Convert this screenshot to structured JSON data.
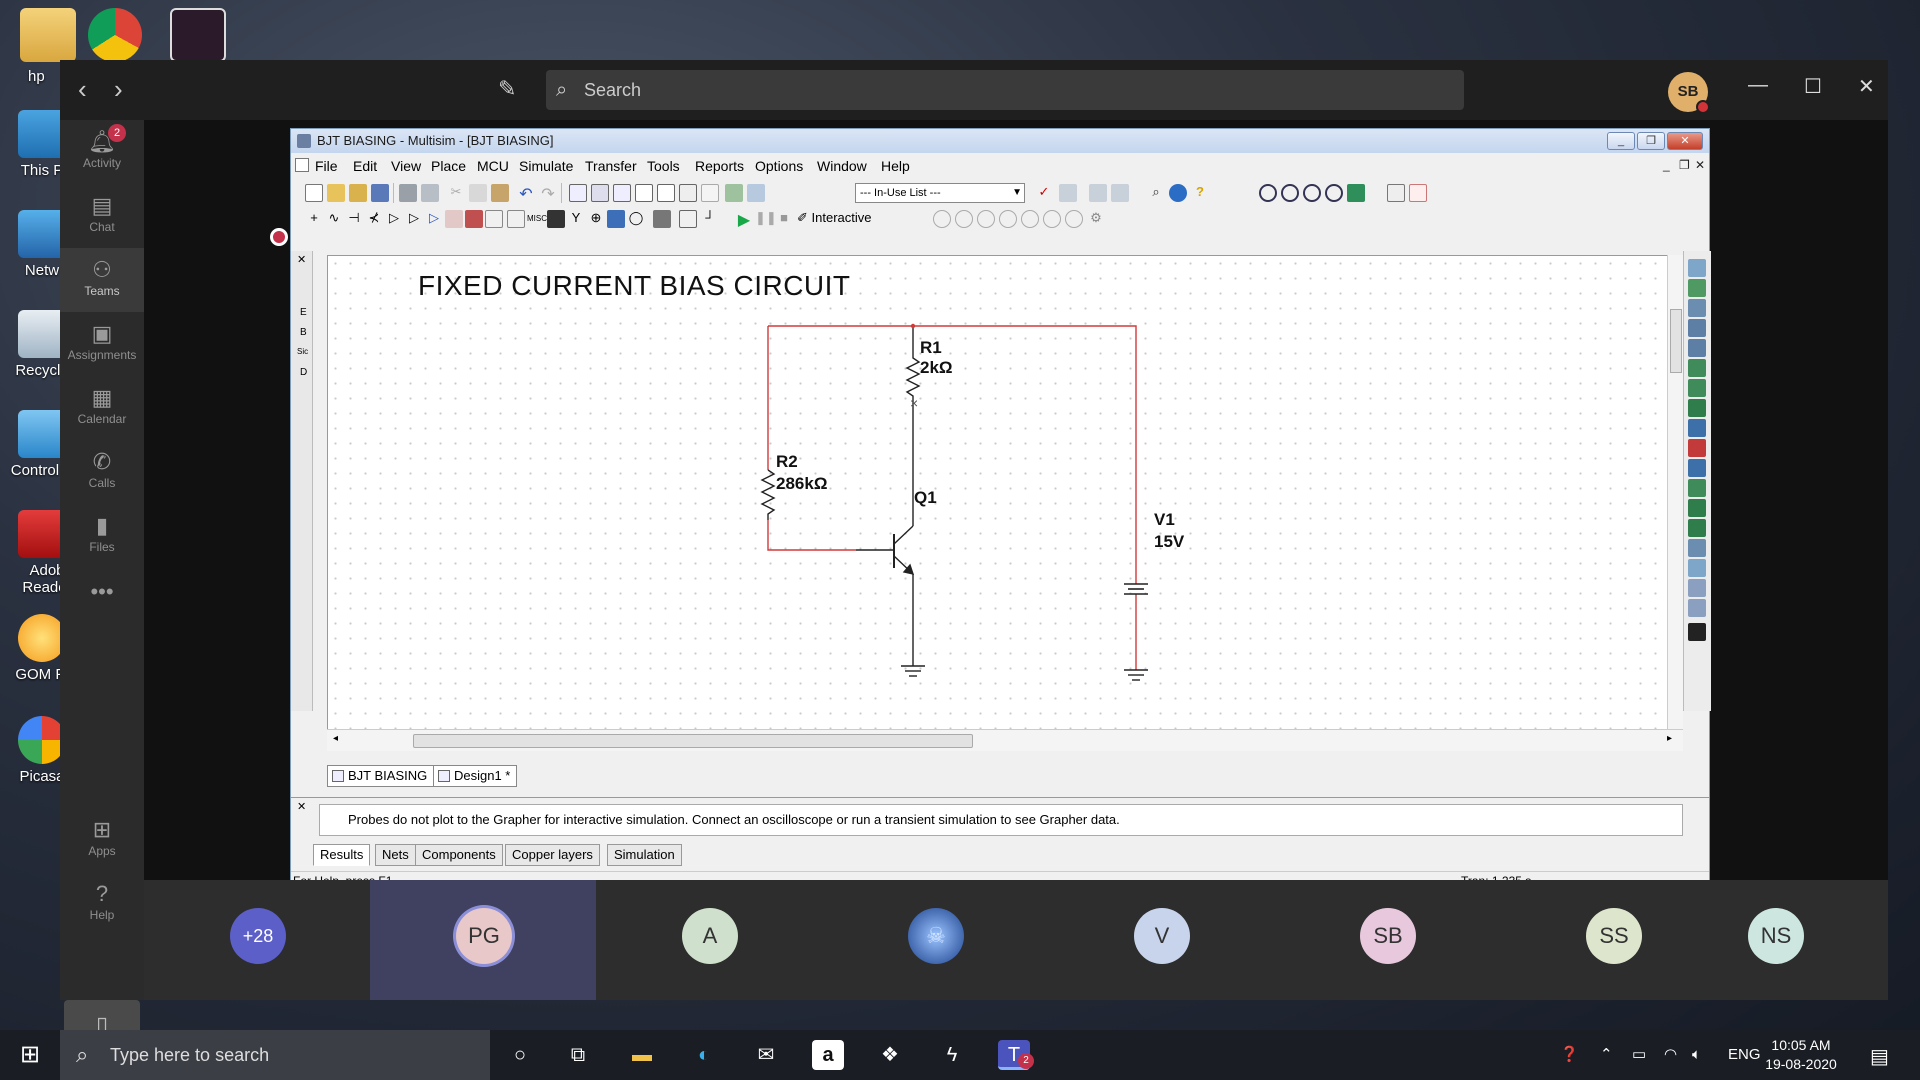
{
  "desktop": {
    "icons": [
      {
        "label": "This P"
      },
      {
        "label": "Netw"
      },
      {
        "label": "Recycle"
      },
      {
        "label": "Control P"
      },
      {
        "label": "Adob Reader"
      },
      {
        "label": "GOM Pl"
      },
      {
        "label": "Picasa"
      }
    ],
    "top_label": "hp"
  },
  "teams": {
    "search_placeholder": "Search",
    "user_initials": "SB",
    "rail": [
      {
        "label": "Activity",
        "badge": "2"
      },
      {
        "label": "Chat"
      },
      {
        "label": "Teams"
      },
      {
        "label": "Assignments"
      },
      {
        "label": "Calendar"
      },
      {
        "label": "Calls"
      },
      {
        "label": "Files"
      },
      {
        "label": "Apps"
      },
      {
        "label": "Help"
      }
    ],
    "participants": [
      {
        "initials": "+28"
      },
      {
        "initials": "PG"
      },
      {
        "initials": "A"
      },
      {
        "initials": ""
      },
      {
        "initials": "V"
      },
      {
        "initials": "SB"
      },
      {
        "initials": "SS"
      },
      {
        "initials": "NS"
      }
    ]
  },
  "multisim": {
    "title": "BJT BIASING - Multisim - [BJT BIASING]",
    "menu": [
      "File",
      "Edit",
      "View",
      "Place",
      "MCU",
      "Simulate",
      "Transfer",
      "Tools",
      "Reports",
      "Options",
      "Window",
      "Help"
    ],
    "in_use_list": "--- In-Use List ---",
    "interactive_label": "Interactive",
    "circuit_title": "FIXED CURRENT BIAS CIRCUIT",
    "components": {
      "r1_name": "R1",
      "r1_value": "2kΩ",
      "r2_name": "R2",
      "r2_value": "286kΩ",
      "q1_name": "Q1",
      "v1_name": "V1",
      "v1_value": "15V"
    },
    "doc_tabs": [
      "BJT BIASING",
      "Design1 *"
    ],
    "output_message": "Probes do not plot to the Grapher for interactive simulation. Connect an oscilloscope or run a transient simulation to see Grapher data.",
    "output_tabs": [
      "Results",
      "Nets",
      "Components",
      "Copper layers",
      "Simulation"
    ],
    "status_left": "For Help, press F1",
    "status_mid": "-",
    "status_right": "Tran: 1.235 s",
    "left_strip_letters": [
      "E",
      "B",
      "Sic",
      "D"
    ]
  },
  "taskbar": {
    "search_placeholder": "Type here to search",
    "lang": "ENG",
    "time": "10:05 AM",
    "date": "19-08-2020",
    "teams_badge": "2"
  },
  "colors": {
    "wire": "#d23a3a",
    "accent": "#5b5fc7"
  }
}
